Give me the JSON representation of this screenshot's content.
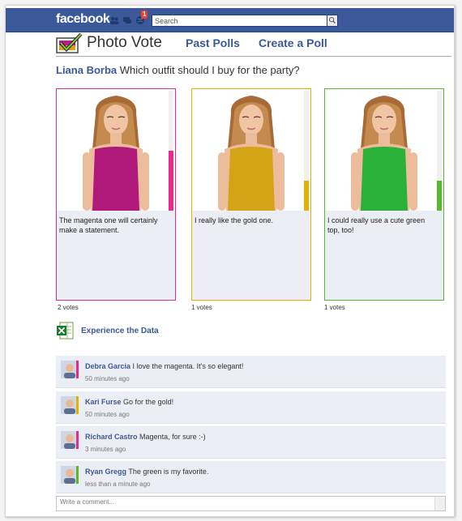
{
  "topbar": {
    "logo": "facebook",
    "notification_count": "1",
    "search_placeholder": "Search"
  },
  "app": {
    "title": "Photo Vote",
    "nav": [
      "Past Polls",
      "Create a Poll"
    ]
  },
  "poll": {
    "author": "Liana Borba",
    "question": "Which outfit should I buy for the party?",
    "options": [
      {
        "caption": "The magenta one will certainly make a statement.",
        "votes_label": "2 votes",
        "votes": 2,
        "color": "#e8298e",
        "dress": "#b0197a",
        "vote_share": 0.5
      },
      {
        "caption": "I really like the gold one.",
        "votes_label": "1 votes",
        "votes": 1,
        "color": "#e5b000",
        "dress": "#d4a416",
        "vote_share": 0.25
      },
      {
        "caption": "I could really use a cute green top, too!",
        "votes_label": "1 votes",
        "votes": 1,
        "color": "#57b92c",
        "dress": "#2ab13a",
        "vote_share": 0.25
      }
    ]
  },
  "experience": {
    "label": "Experience the Data"
  },
  "comments": [
    {
      "author": "Debra Garcia",
      "text": "I love the magenta. It's so elegant!",
      "time": "50 minutes ago",
      "accent": "#e8298e"
    },
    {
      "author": "Kari Furse",
      "text": "Go for the gold!",
      "time": "50 minutes ago",
      "accent": "#e5b000"
    },
    {
      "author": "Richard Castro",
      "text": "Magenta, for sure :-)",
      "time": "3 minutes ago",
      "accent": "#e8298e"
    },
    {
      "author": "Ryan Gregg",
      "text": "The green is my favorite.",
      "time": "less than a minute ago",
      "accent": "#57b92c"
    }
  ],
  "comment_box": {
    "placeholder": "Write a comment..."
  }
}
